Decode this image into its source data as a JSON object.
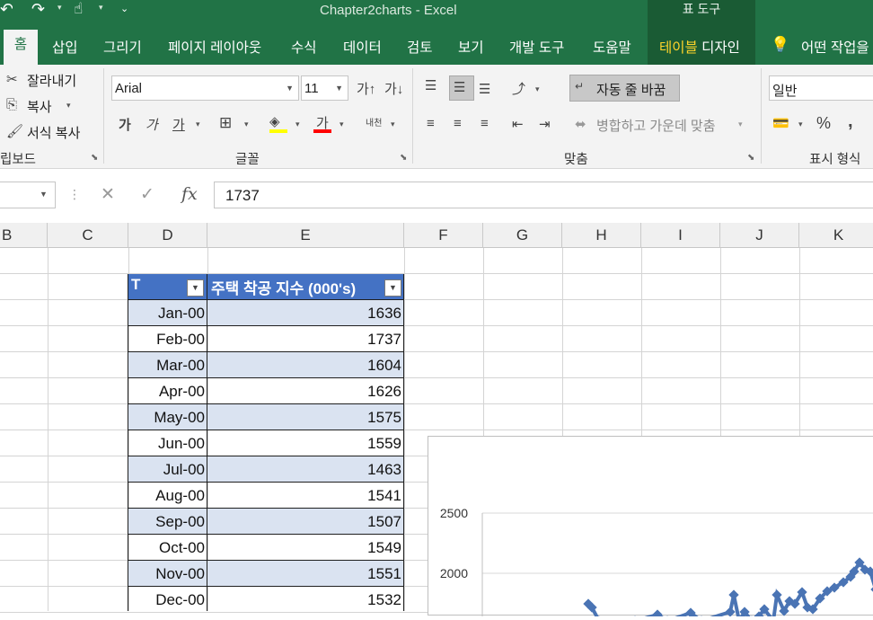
{
  "window": {
    "title": "Chapter2charts  -  Excel",
    "tool_title": "표 도구"
  },
  "quick_access": {
    "undo_icon": "undo-icon",
    "redo_icon": "redo-icon",
    "touch_icon": "touch-mode-icon",
    "more": "⌄"
  },
  "tabs": [
    {
      "label": "홈",
      "active": true
    },
    {
      "label": "삽입"
    },
    {
      "label": "그리기"
    },
    {
      "label": "페이지 레이아웃"
    },
    {
      "label": "수식"
    },
    {
      "label": "데이터"
    },
    {
      "label": "검토"
    },
    {
      "label": "보기"
    },
    {
      "label": "개발 도구"
    },
    {
      "label": "도움말"
    }
  ],
  "table_design_tab": {
    "highlight": "테이블",
    "rest": " 디자인"
  },
  "tell_me": "어떤 작업을",
  "ribbon": {
    "clipboard": {
      "cut": "잘라내기",
      "copy": "복사",
      "format_painter": "서식 복사",
      "group_label": "립보드"
    },
    "font": {
      "name": "Arial",
      "size": "11",
      "bold": "가",
      "italic": "가",
      "underline": "가",
      "font_color_glyph": "가",
      "phonetic": "내천",
      "group_label": "글꼴",
      "highlight_color": "#ffff00",
      "font_color": "#ff0000"
    },
    "alignment": {
      "wrap_text": "자동 줄 바꿈",
      "merge_center": "병합하고 가운데 맞춤",
      "group_label": "맞춤"
    },
    "number": {
      "format": "일반",
      "percent": "%",
      "comma": ",",
      "group_label": "표시 형식"
    }
  },
  "formula_bar": {
    "cancel": "✕",
    "enter": "✓",
    "fx": "fx",
    "value": "1737"
  },
  "columns": [
    "B",
    "C",
    "D",
    "E",
    "F",
    "G",
    "H",
    "I",
    "J",
    "K"
  ],
  "table": {
    "header_color": "#4472c4",
    "band_color": "#dae3f1",
    "headers": [
      "T",
      "주택 착공 지수 (000's)"
    ],
    "rows": [
      [
        "Jan-00",
        "1636"
      ],
      [
        "Feb-00",
        "1737"
      ],
      [
        "Mar-00",
        "1604"
      ],
      [
        "Apr-00",
        "1626"
      ],
      [
        "May-00",
        "1575"
      ],
      [
        "Jun-00",
        "1559"
      ],
      [
        "Jul-00",
        "1463"
      ],
      [
        "Aug-00",
        "1541"
      ],
      [
        "Sep-00",
        "1507"
      ],
      [
        "Oct-00",
        "1549"
      ],
      [
        "Nov-00",
        "1551"
      ],
      [
        "Dec-00",
        "1532"
      ]
    ]
  },
  "chart": {
    "series_color": "#4a74b4",
    "y_ticks": [
      "2500",
      "2000"
    ]
  }
}
